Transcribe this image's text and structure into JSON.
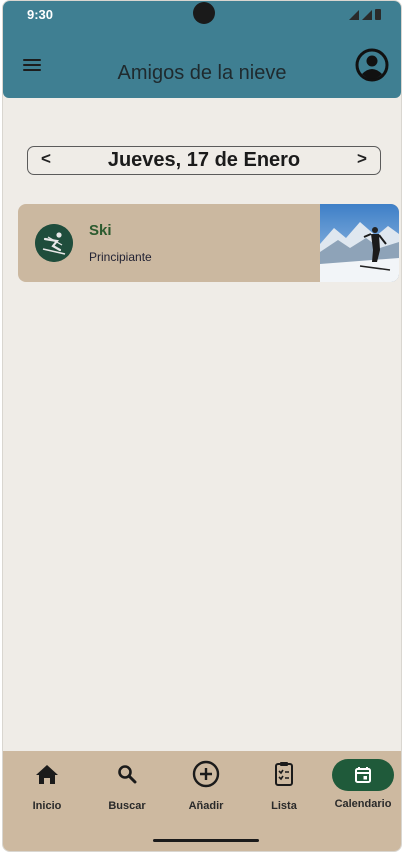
{
  "status_bar": {
    "time": "9:30"
  },
  "header": {
    "title": "Amigos de la nieve",
    "menu_icon": "menu-icon",
    "profile_icon": "account-circle-icon"
  },
  "date_nav": {
    "prev_label": "<",
    "date": "Jueves, 17 de Enero",
    "next_label": ">"
  },
  "activities": [
    {
      "title": "Ski",
      "level": "Principiante",
      "icon": "skier-icon",
      "photo": "skier-photo"
    }
  ],
  "bottom_nav": {
    "items": [
      {
        "label": "Inicio",
        "icon": "home-icon"
      },
      {
        "label": "Buscar",
        "icon": "search-icon"
      },
      {
        "label": "Añadir",
        "icon": "add-circle-icon"
      },
      {
        "label": "Lista",
        "icon": "clipboard-list-icon"
      },
      {
        "label": "Calendario",
        "icon": "calendar-icon",
        "active": true
      }
    ]
  },
  "colors": {
    "header_bg": "#3f7f92",
    "page_bg": "#efece7",
    "card_bg": "#cbb8a0",
    "nav_bg": "#cdb9a0",
    "active_pill": "#1f5a3a",
    "activity_title": "#2b5a2e"
  }
}
